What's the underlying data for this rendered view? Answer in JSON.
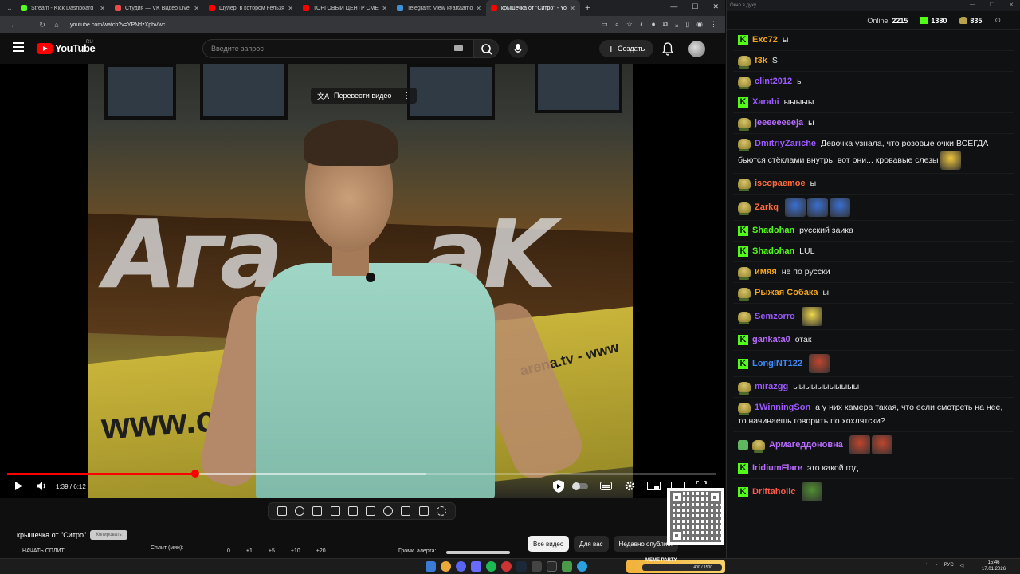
{
  "browser": {
    "tabs": [
      {
        "title": "Stream - Kick Dashboard",
        "color": "#53fc18",
        "active": false
      },
      {
        "title": "Студия — VK Видео Live",
        "color": "#e84b4b",
        "active": false
      },
      {
        "title": "Шулер, в котором нельзя стр...",
        "color": "#ff0000",
        "active": false
      },
      {
        "title": "ТОРГОВЫЙ ЦЕНТР СМЕРТИ -...",
        "color": "#ff0000",
        "active": false
      },
      {
        "title": "Telegram: View @artaamonova...",
        "color": "#3f8fd2",
        "active": false
      },
      {
        "title": "крышечка от \"Ситро\" - Yo...",
        "color": "#ff0000",
        "active": true
      }
    ],
    "url": "youtube.com/watch?v=YPNdzXpbVwc"
  },
  "youtube": {
    "brand": "YouTube",
    "region": "RU",
    "search_placeholder": "Введите запрос",
    "create_label": "Создать"
  },
  "video": {
    "translate_label": "Перевести видео",
    "time_display": "1:39 / 6:12",
    "progress_fraction": 0.265,
    "buffer_fraction": 0.59,
    "frame_text": {
      "logo_left": "Aгa",
      "logo_right": "аK",
      "site_left": "www.cybe",
      "site_right": "arena.tv - www"
    }
  },
  "below": {
    "title": "крышечка от \"Ситро\"",
    "badge": "Копировать",
    "split_button": "НАЧАТЬ СПЛИТ",
    "split_label": "Сплит (мин):",
    "split_values": [
      "0",
      "+1",
      "+5",
      "+10",
      "+20"
    ],
    "alert_label": "Громк. алерта:",
    "chips": [
      {
        "label": "Все видео",
        "active": true
      },
      {
        "label": "Для вас",
        "active": false
      },
      {
        "label": "Недавно опубли...",
        "active": false
      }
    ]
  },
  "chat": {
    "window_title": "Окно в духу",
    "online_label": "Online:",
    "online_count": "2215",
    "kick_count": "1380",
    "other_count": "835",
    "messages": [
      {
        "badge": "kick",
        "user": "Exc72",
        "color": "#f2a51e",
        "text": "ы",
        "emotes": []
      },
      {
        "badge": "pepe",
        "user": "f3k",
        "color": "#f2a51e",
        "text": "S",
        "emotes": []
      },
      {
        "badge": "pepe",
        "user": "clint2012",
        "color": "#9b59ff",
        "text": "ы",
        "emotes": []
      },
      {
        "badge": "kick",
        "user": "Xarabi",
        "color": "#9b59ff",
        "text": "ыыыыы",
        "emotes": []
      },
      {
        "badge": "pepe",
        "user": "jeeeeeeeeja",
        "color": "#b86bff",
        "text": "ы",
        "emotes": []
      },
      {
        "badge": "pepe",
        "user": "DmitriyZariche",
        "color": "#9b59ff",
        "text": "Девочка узнала, что розовые очки ВСЕГДА бьются стёклами внутрь. вот они... кровавые слезы",
        "emotes": [
          "#f0c63c"
        ]
      },
      {
        "badge": "pepe",
        "user": "iscopaemoe",
        "color": "#ff6b3d",
        "text": "ы",
        "emotes": []
      },
      {
        "badge": "pepe",
        "user": "Zarkq",
        "color": "#ff6b3d",
        "text": "",
        "emotes": [
          "#3b6fd1",
          "#3b6fd1",
          "#3b6fd1"
        ]
      },
      {
        "badge": "kick",
        "user": "Shadohan",
        "color": "#53fc18",
        "text": "русский заика",
        "emotes": []
      },
      {
        "badge": "kick",
        "user": "Shadohan",
        "color": "#53fc18",
        "text": "LUL",
        "emotes": []
      },
      {
        "badge": "pepe",
        "user": "имяя",
        "color": "#f2a51e",
        "text": "не по русски",
        "emotes": []
      },
      {
        "badge": "pepe",
        "user": "Рыжая Собака",
        "color": "#f2a51e",
        "text": "ы",
        "emotes": []
      },
      {
        "badge": "pepe",
        "user": "Semzorro",
        "color": "#9b59ff",
        "text": "",
        "emotes": [
          "#f0d84a"
        ]
      },
      {
        "badge": "kick",
        "user": "gankata0",
        "color": "#b86bff",
        "text": "отак",
        "emotes": []
      },
      {
        "badge": "kick",
        "user": "LongINT122",
        "color": "#3d8bff",
        "text": "",
        "emotes": [
          "#c0452e"
        ]
      },
      {
        "badge": "pepe",
        "user": "mirazgg",
        "color": "#9b59ff",
        "text": "ыыыыыыыыыыы",
        "emotes": []
      },
      {
        "badge": "pepe",
        "user": "1WinningSon",
        "color": "#9b59ff",
        "text": "а у них камера такая, что если смотреть на нее, то начинаешь говорить по хохлятски?",
        "emotes": []
      },
      {
        "badge": "shield+pepe",
        "user": "Армагеддоновна",
        "color": "#b86bff",
        "text": "",
        "emotes": [
          "#c0452e",
          "#c0452e"
        ]
      },
      {
        "badge": "kick",
        "user": "IridiumFlare",
        "color": "#b86bff",
        "text": "это какой год",
        "emotes": []
      },
      {
        "badge": "kick",
        "user": "Driftaholic",
        "color": "#ff5a4a",
        "text": "",
        "emotes": [
          "#4f8f2f"
        ]
      }
    ]
  },
  "taskbar": {
    "meme_label": "MEME PARTY",
    "meme_value": "400 / 1500",
    "lang": "РУС",
    "time": "15:46",
    "date": "17.01.2026"
  }
}
